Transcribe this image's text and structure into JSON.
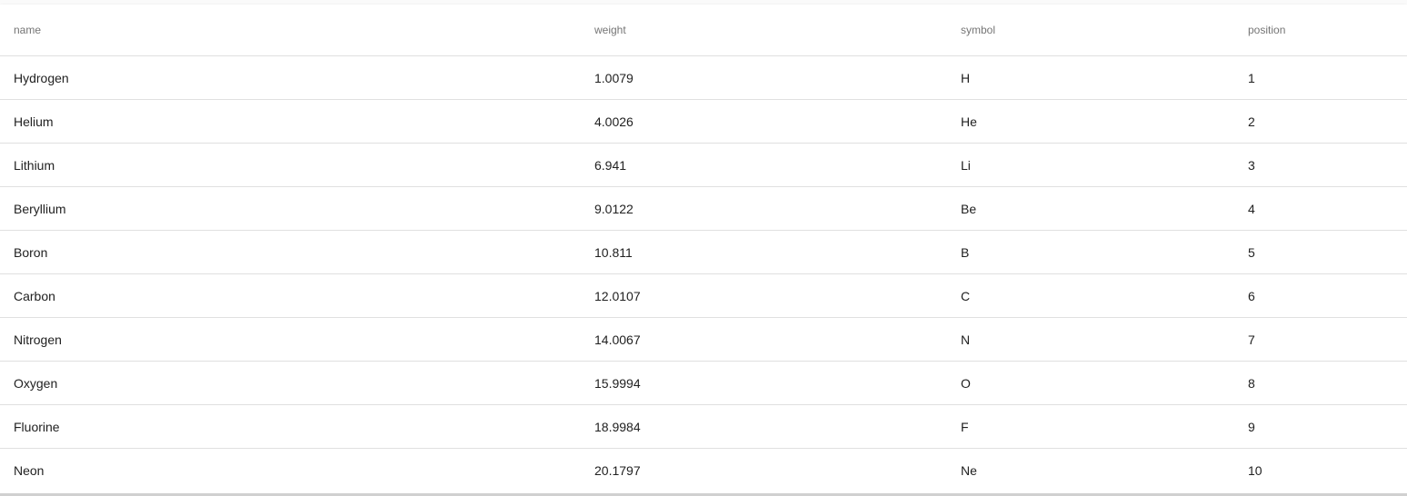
{
  "table": {
    "columns": [
      "name",
      "weight",
      "symbol",
      "position"
    ],
    "rows": [
      {
        "name": "Hydrogen",
        "weight": "1.0079",
        "symbol": "H",
        "position": "1"
      },
      {
        "name": "Helium",
        "weight": "4.0026",
        "symbol": "He",
        "position": "2"
      },
      {
        "name": "Lithium",
        "weight": "6.941",
        "symbol": "Li",
        "position": "3"
      },
      {
        "name": "Beryllium",
        "weight": "9.0122",
        "symbol": "Be",
        "position": "4"
      },
      {
        "name": "Boron",
        "weight": "10.811",
        "symbol": "B",
        "position": "5"
      },
      {
        "name": "Carbon",
        "weight": "12.0107",
        "symbol": "C",
        "position": "6"
      },
      {
        "name": "Nitrogen",
        "weight": "14.0067",
        "symbol": "N",
        "position": "7"
      },
      {
        "name": "Oxygen",
        "weight": "15.9994",
        "symbol": "O",
        "position": "8"
      },
      {
        "name": "Fluorine",
        "weight": "18.9984",
        "symbol": "F",
        "position": "9"
      },
      {
        "name": "Neon",
        "weight": "20.1797",
        "symbol": "Ne",
        "position": "10"
      }
    ]
  },
  "colors": {
    "header_text": "#757575",
    "cell_text": "#212121",
    "row_divider": "#e0e0e0",
    "background": "#ffffff"
  }
}
